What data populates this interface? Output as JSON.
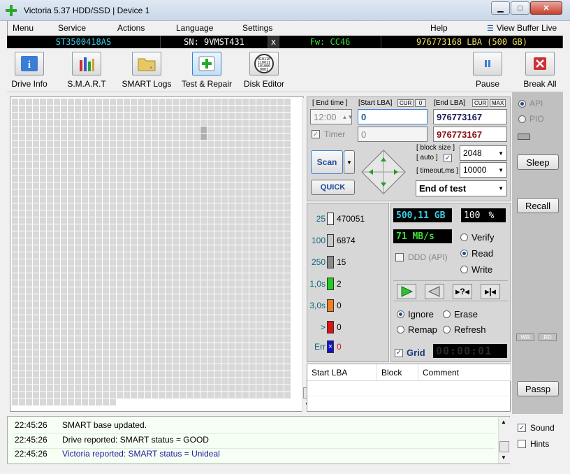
{
  "window": {
    "title": "Victoria 5.37 HDD/SSD | Device 1"
  },
  "menu": {
    "items": [
      "Menu",
      "Service",
      "Actions",
      "Language",
      "Settings",
      "Help"
    ],
    "view_buffer": "View Buffer Live"
  },
  "infobar": {
    "model": "ST3500418AS",
    "serial": "SN: 9VMST431",
    "close": "x",
    "firmware": "Fw: CC46",
    "lba": "976773168 LBA (500 GB)"
  },
  "toolbar": {
    "drive_info": "Drive Info",
    "smart": "S.M.A.R.T",
    "smart_logs": "SMART Logs",
    "test_repair": "Test & Repair",
    "disk_editor": "Disk Editor",
    "pause": "Pause",
    "break_all": "Break All",
    "disk_editor_icon_text": "010110\n110011\n101000\n0001"
  },
  "control": {
    "end_time_label": "[ End time ]",
    "end_time_value": "12:00",
    "start_lba_label": "[Start LBA]",
    "cur_tag": "CUR",
    "zero_tag": "0",
    "start_lba_value": "0",
    "end_lba_label": "[End LBA]",
    "max_tag": "MAX",
    "end_lba_value": "976773167",
    "timer_label": "Timer",
    "timer_value": "0",
    "end_lba_value2": "976773167",
    "block_size_label": "[ block size ]",
    "auto_label": "[ auto ]",
    "block_size_value": "2048",
    "timeout_label": "[ timeout,ms ]",
    "timeout_value": "10000",
    "scan_button": "Scan",
    "quick_button": "QUICK",
    "end_action": "End of test"
  },
  "stats": [
    {
      "label": "25",
      "value": "470051",
      "color": "#f4f4f4"
    },
    {
      "label": "100",
      "value": "6874",
      "color": "#c8c8c8"
    },
    {
      "label": "250",
      "value": "15",
      "color": "#8a8a8a"
    },
    {
      "label": "1,0s",
      "value": "2",
      "color": "#22cc22"
    },
    {
      "label": "3,0s",
      "value": "0",
      "color": "#f08020"
    },
    {
      "label": ">",
      "value": "0",
      "color": "#dd1111"
    },
    {
      "label": "Err",
      "value": "0",
      "color": "#1111cc"
    }
  ],
  "status": {
    "capacity": "500,11 GB",
    "percent": "100",
    "percent_sign": "%",
    "speed": "71 MB/s",
    "ddd_label": "DDD (API)",
    "verify": "Verify",
    "read": "Read",
    "write": "Write",
    "ignore": "Ignore",
    "erase": "Erase",
    "remap": "Remap",
    "refresh": "Refresh",
    "grid": "Grid",
    "elapsed": "00:00:01",
    "mode": "Read",
    "action": "Ignore"
  },
  "table": {
    "columns": [
      "Start LBA",
      "Block",
      "Comment"
    ]
  },
  "side": {
    "api": "API",
    "pio": "PIO",
    "sleep": "Sleep",
    "recall": "Recall",
    "wr": "WR",
    "rd": "RD",
    "passp": "Passp"
  },
  "log": [
    {
      "time": "22:45:26",
      "msg": "SMART base updated.",
      "color": "#000000"
    },
    {
      "time": "22:45:26",
      "msg": "Drive reported: SMART status = GOOD",
      "color": "#000000"
    },
    {
      "time": "22:45:26",
      "msg": "Victoria reported: SMART status = Unideal",
      "color": "#1a1a9a"
    }
  ],
  "options": {
    "sound": "Sound",
    "hints": "Hints"
  },
  "colors": {
    "lcd_green": "#38e038",
    "lcd_cyan": "#3ad0e8",
    "grid_cell": "#d8d8d8",
    "grid_highlight": "#b0b0b0"
  }
}
